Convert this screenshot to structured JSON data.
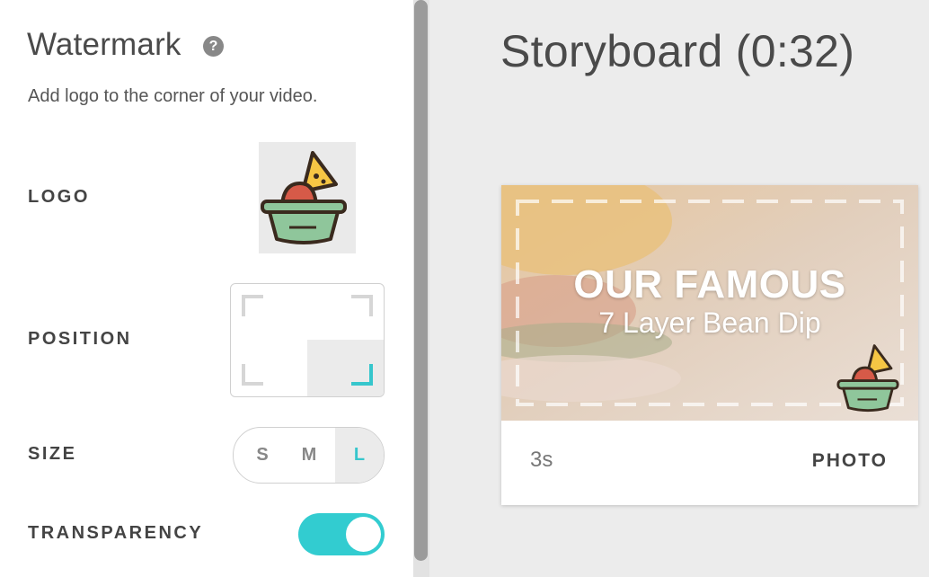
{
  "watermark_panel": {
    "title": "Watermark",
    "help_icon": "question-circle-icon",
    "description": "Add logo to the corner of your video.",
    "logo_label": "LOGO",
    "logo_icon": "guacamole-chip-bowl-icon",
    "position_label": "POSITION",
    "position_selected": "bottom-right",
    "size_label": "SIZE",
    "size_options": [
      "S",
      "M",
      "L"
    ],
    "size_selected": "L",
    "transparency_label": "TRANSPARENCY",
    "transparency_on": true
  },
  "storyboard": {
    "title": "Storyboard (0:32)",
    "card": {
      "overlay_headline": "OUR FAMOUS",
      "overlay_subtitle": "7 Layer Bean Dip",
      "duration": "3s",
      "type": "PHOTO"
    }
  },
  "colors": {
    "accent": "#32ccd0",
    "panel_bg": "#ffffff",
    "page_bg": "#ececec",
    "text_dark": "#444444"
  }
}
